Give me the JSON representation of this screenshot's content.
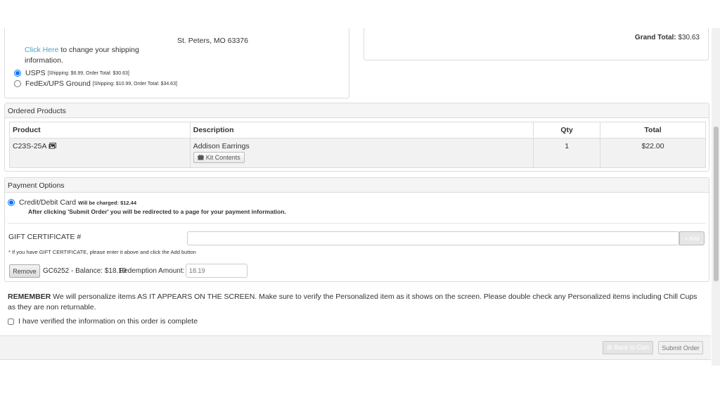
{
  "shipping": {
    "click_here": "Click Here",
    "change_text": " to change your shipping information.",
    "address_line": "St. Peters, MO 63376",
    "options": [
      {
        "label": "USPS",
        "detail": "[Shipping: $6.99, Order Total: $30.63]",
        "selected": true
      },
      {
        "label": "FedEx/UPS Ground",
        "detail": "[Shipping: $10.99, Order Total: $34.63]",
        "selected": false
      }
    ]
  },
  "summary": {
    "grand_total_label": "Grand Total:",
    "grand_total_value": "$30.63"
  },
  "ordered_products": {
    "title": "Ordered Products",
    "columns": [
      "Product",
      "Description",
      "Qty",
      "Total"
    ],
    "rows": [
      {
        "product": "C23S-25A",
        "description": "Addison Earrings",
        "kit_button": "Kit Contents",
        "qty": "1",
        "total": "$22.00"
      }
    ]
  },
  "payment": {
    "title": "Payment Options",
    "card_label": "Credit/Debit Card",
    "charge_text": "Will be charged: $12.44",
    "redirect_note": "After clicking 'Submit Order' you will be redirected to a page for your payment information.",
    "gift_label": "GIFT CERTIFICATE #",
    "gift_input_value": "",
    "add_button": "+ Add",
    "gift_note": "* If you have GIFT CERTIFICATE, please enter it above and click the Add button",
    "remove_button": "Remove",
    "gift_balance": "GC6252 - Balance: $18.19",
    "redemption_label": "Redemption Amount:",
    "redemption_value": "18.19"
  },
  "remember": {
    "bold": "REMEMBER",
    "text": " We will personalize items AS IT APPEARS ON THE SCREEN. Make sure to verify the Personalized item as it shows on the screen. Please double check any Personalized items including Chill Cups as they are non returnable."
  },
  "verify": {
    "label": "I have verified the information on this order is complete"
  },
  "footer": {
    "back_button": "Back to Cart",
    "submit_button": "Submit Order"
  }
}
